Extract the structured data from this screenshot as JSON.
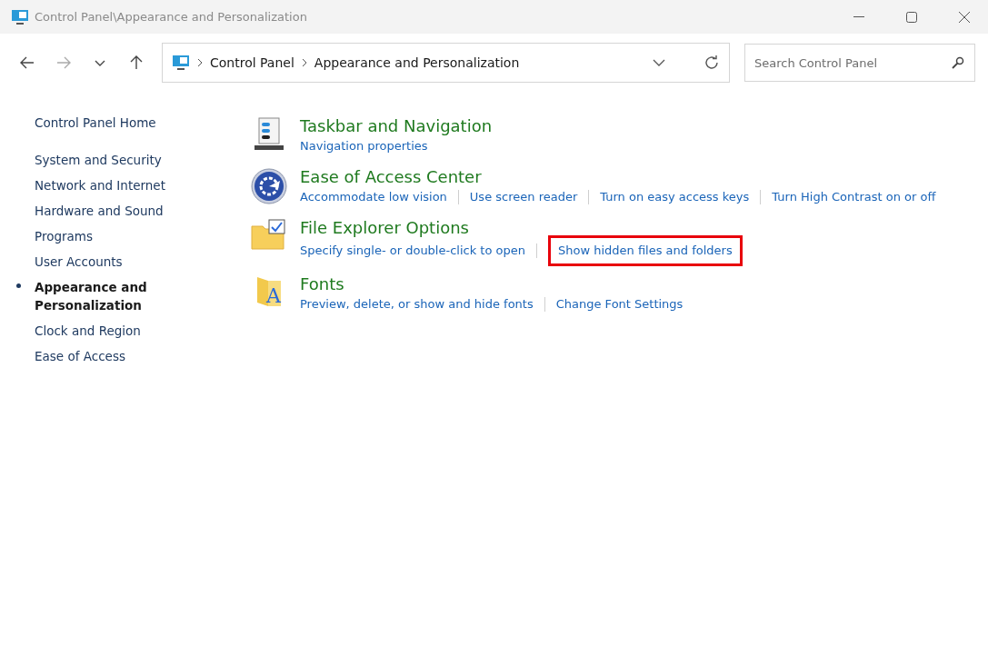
{
  "window": {
    "title": "Control Panel\\Appearance and Personalization"
  },
  "address_bar": {
    "crumbs": [
      "Control Panel",
      "Appearance and Personalization"
    ]
  },
  "search": {
    "placeholder": "Search Control Panel"
  },
  "sidebar": {
    "home": "Control Panel Home",
    "items": [
      {
        "label": "System and Security",
        "selected": false
      },
      {
        "label": "Network and Internet",
        "selected": false
      },
      {
        "label": "Hardware and Sound",
        "selected": false
      },
      {
        "label": "Programs",
        "selected": false
      },
      {
        "label": "User Accounts",
        "selected": false
      },
      {
        "label": "Appearance and Personalization",
        "selected": true
      },
      {
        "label": "Clock and Region",
        "selected": false
      },
      {
        "label": "Ease of Access",
        "selected": false
      }
    ]
  },
  "categories": [
    {
      "kind": "taskbar",
      "title": "Taskbar and Navigation",
      "links": [
        {
          "label": "Navigation properties",
          "highlighted": false
        }
      ]
    },
    {
      "kind": "access",
      "title": "Ease of Access Center",
      "links": [
        {
          "label": "Accommodate low vision",
          "highlighted": false
        },
        {
          "label": "Use screen reader",
          "highlighted": false
        },
        {
          "label": "Turn on easy access keys",
          "highlighted": false
        },
        {
          "label": "Turn High Contrast on or off",
          "highlighted": false
        }
      ]
    },
    {
      "kind": "folder",
      "title": "File Explorer Options",
      "links": [
        {
          "label": "Specify single- or double-click to open",
          "highlighted": false
        },
        {
          "label": "Show hidden files and folders",
          "highlighted": true
        }
      ]
    },
    {
      "kind": "fonts",
      "icon_letter": "A",
      "title": "Fonts",
      "links": [
        {
          "label": "Preview, delete, or show and hide fonts",
          "highlighted": false
        },
        {
          "label": "Change Font Settings",
          "highlighted": false
        }
      ]
    }
  ]
}
